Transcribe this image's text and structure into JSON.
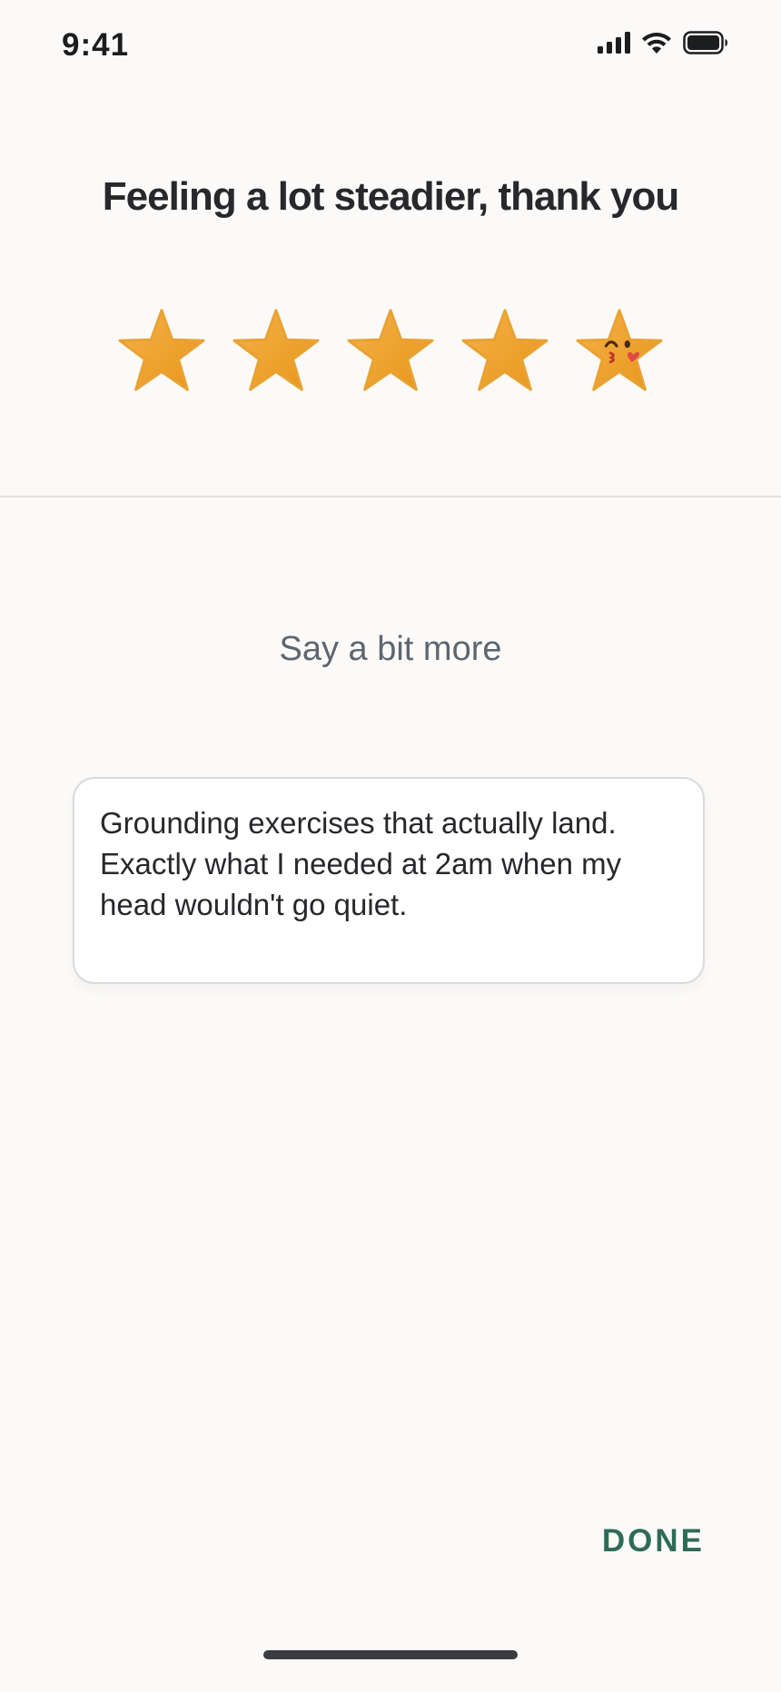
{
  "status_bar": {
    "time": "9:41",
    "icons": [
      "signal-icon",
      "wifi-icon",
      "battery-icon"
    ]
  },
  "rating": {
    "title": "Feeling a lot steadier, thank you",
    "value": 5,
    "max": 5,
    "selected_emoji": "kissing-star-icon",
    "star_color": "#F0A530"
  },
  "comment": {
    "prompt": "Say a bit more",
    "value": "Grounding exercises that actually land. Exactly what I needed at 2am when my head wouldn't go quiet."
  },
  "actions": {
    "done_label": "DONE",
    "accent_color": "#2E6B58"
  }
}
